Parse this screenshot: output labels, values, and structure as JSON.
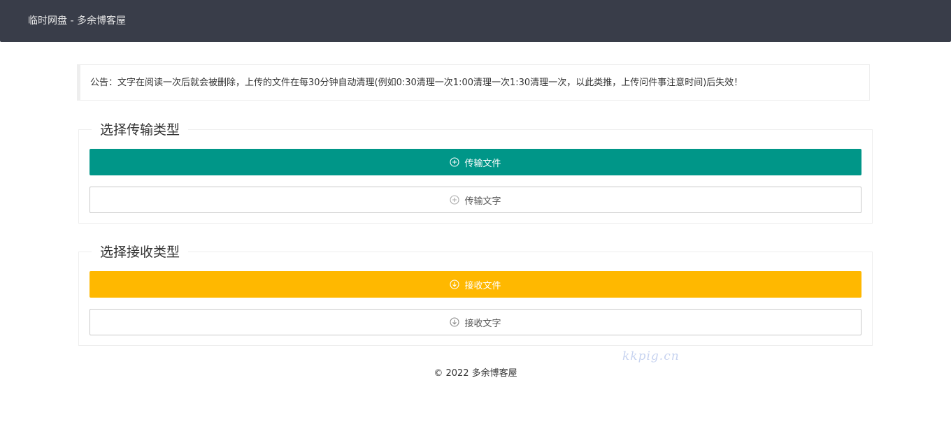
{
  "header": {
    "title": "临时网盘 - 多余博客屋"
  },
  "notice": {
    "text": "公告：文字在阅读一次后就会被删除，上传的文件在每30分钟自动清理(例如0:30清理一次1:00清理一次1:30清理一次，以此类推，上传问件事注意时间)后失效！"
  },
  "send": {
    "legend": "选择传输类型",
    "file_button": {
      "label": "传输文件",
      "icon": "plus-circle-icon",
      "color": "#009688"
    },
    "text_button": {
      "label": "传输文字",
      "icon": "plus-circle-icon"
    }
  },
  "receive": {
    "legend": "选择接收类型",
    "file_button": {
      "label": "接收文件",
      "icon": "download-circle-icon",
      "color": "#ffb800"
    },
    "text_button": {
      "label": "接收文字",
      "icon": "download-circle-icon"
    }
  },
  "footer": {
    "text": "© 2022 多余博客屋"
  },
  "watermark": {
    "text": "kkpig.cn"
  },
  "colors": {
    "header_bg": "#393d49",
    "primary": "#009688",
    "warning": "#ffb800"
  }
}
